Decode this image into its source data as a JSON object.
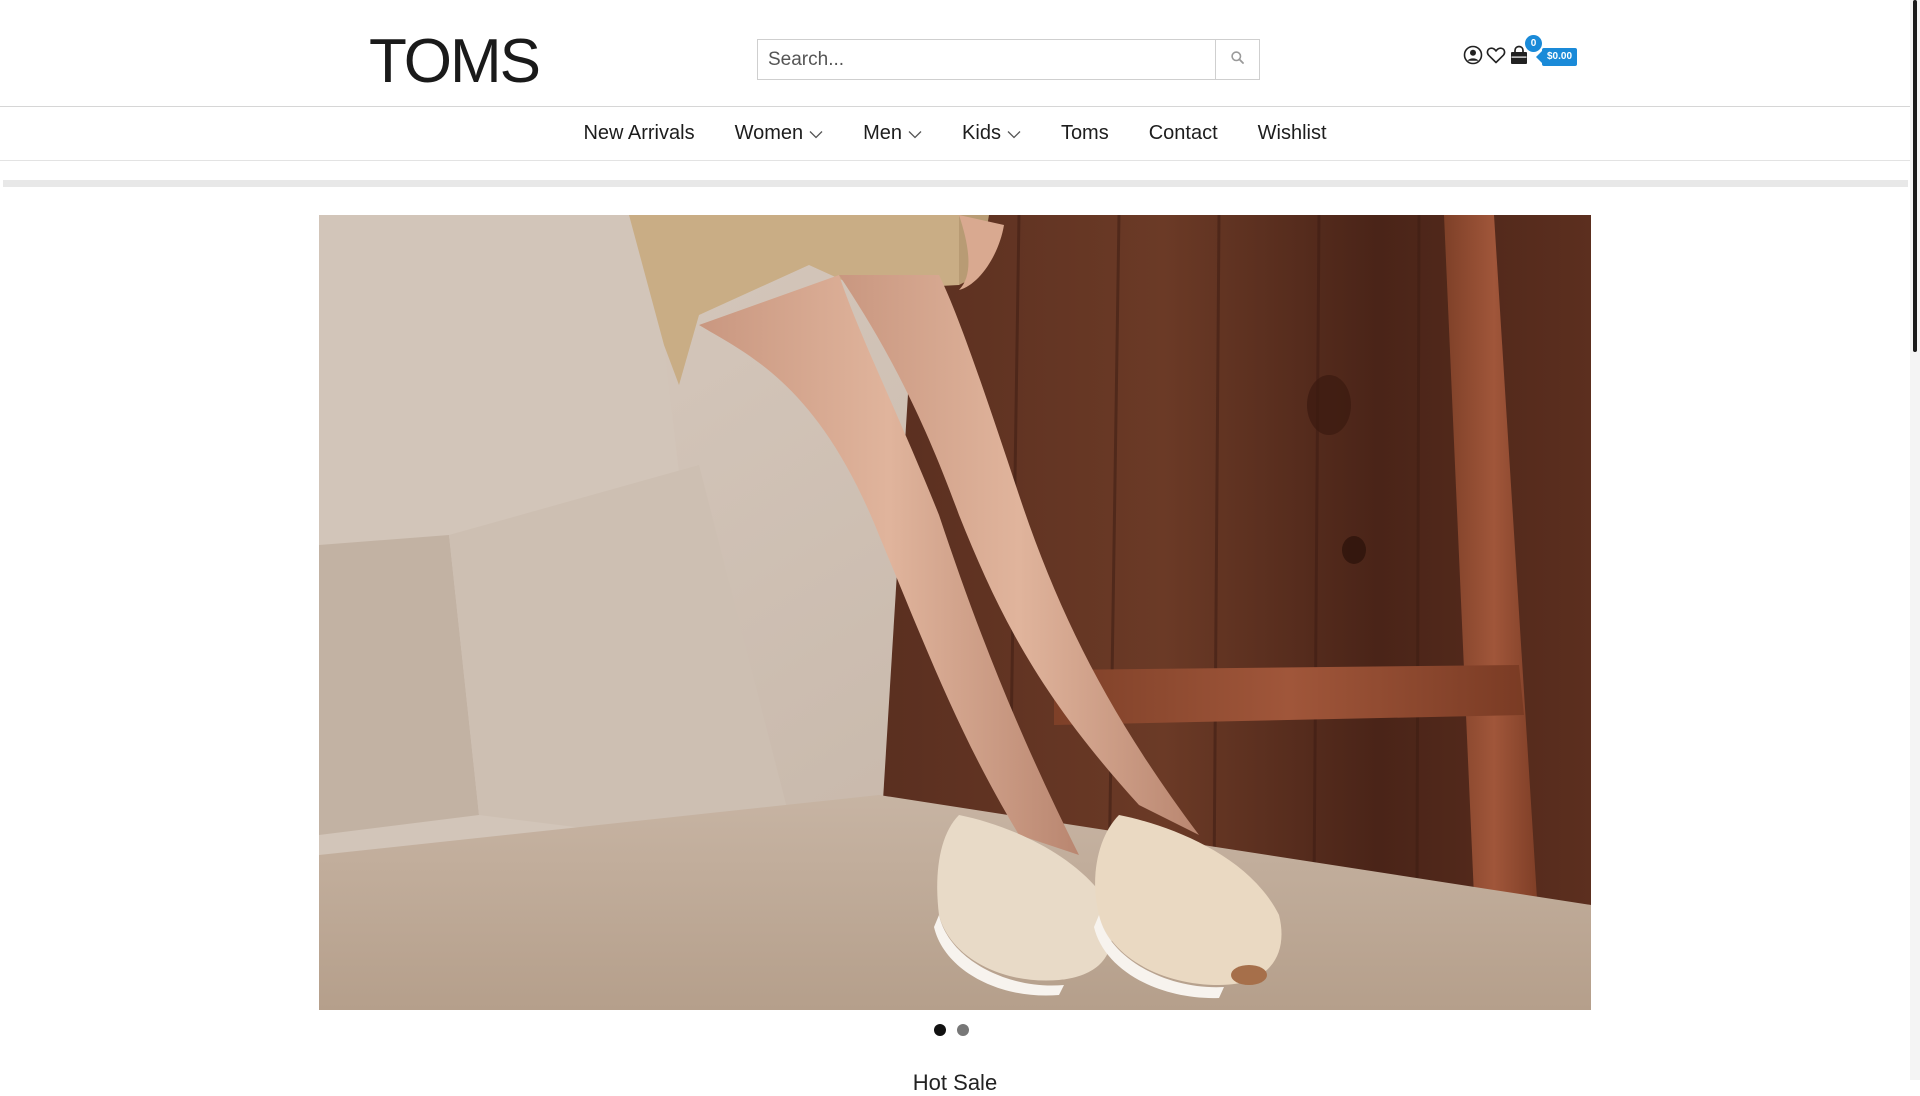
{
  "brand": {
    "logo_text": "TOMS"
  },
  "search": {
    "placeholder": "Search...",
    "icon": "search-icon"
  },
  "header_icons": {
    "account": "user-circle-icon",
    "wishlist": "heart-icon",
    "cart": "shopping-bag-icon"
  },
  "cart": {
    "count": "0",
    "total": "$0.00"
  },
  "colors": {
    "accent": "#1a8ad8",
    "text": "#1d1d1d",
    "border": "#d6d6d6"
  },
  "nav": {
    "items": [
      {
        "label": "New Arrivals",
        "has_dropdown": false
      },
      {
        "label": "Women",
        "has_dropdown": true
      },
      {
        "label": "Men",
        "has_dropdown": true
      },
      {
        "label": "Kids",
        "has_dropdown": true
      },
      {
        "label": "Toms",
        "has_dropdown": false
      },
      {
        "label": "Contact",
        "has_dropdown": false
      },
      {
        "label": "Wishlist",
        "has_dropdown": false
      }
    ]
  },
  "hero": {
    "slides_total": 2,
    "active_slide": 1,
    "image": "photo of legs in beige slip-on sneakers against concrete and wooden fence"
  },
  "section": {
    "title": "Hot Sale"
  }
}
